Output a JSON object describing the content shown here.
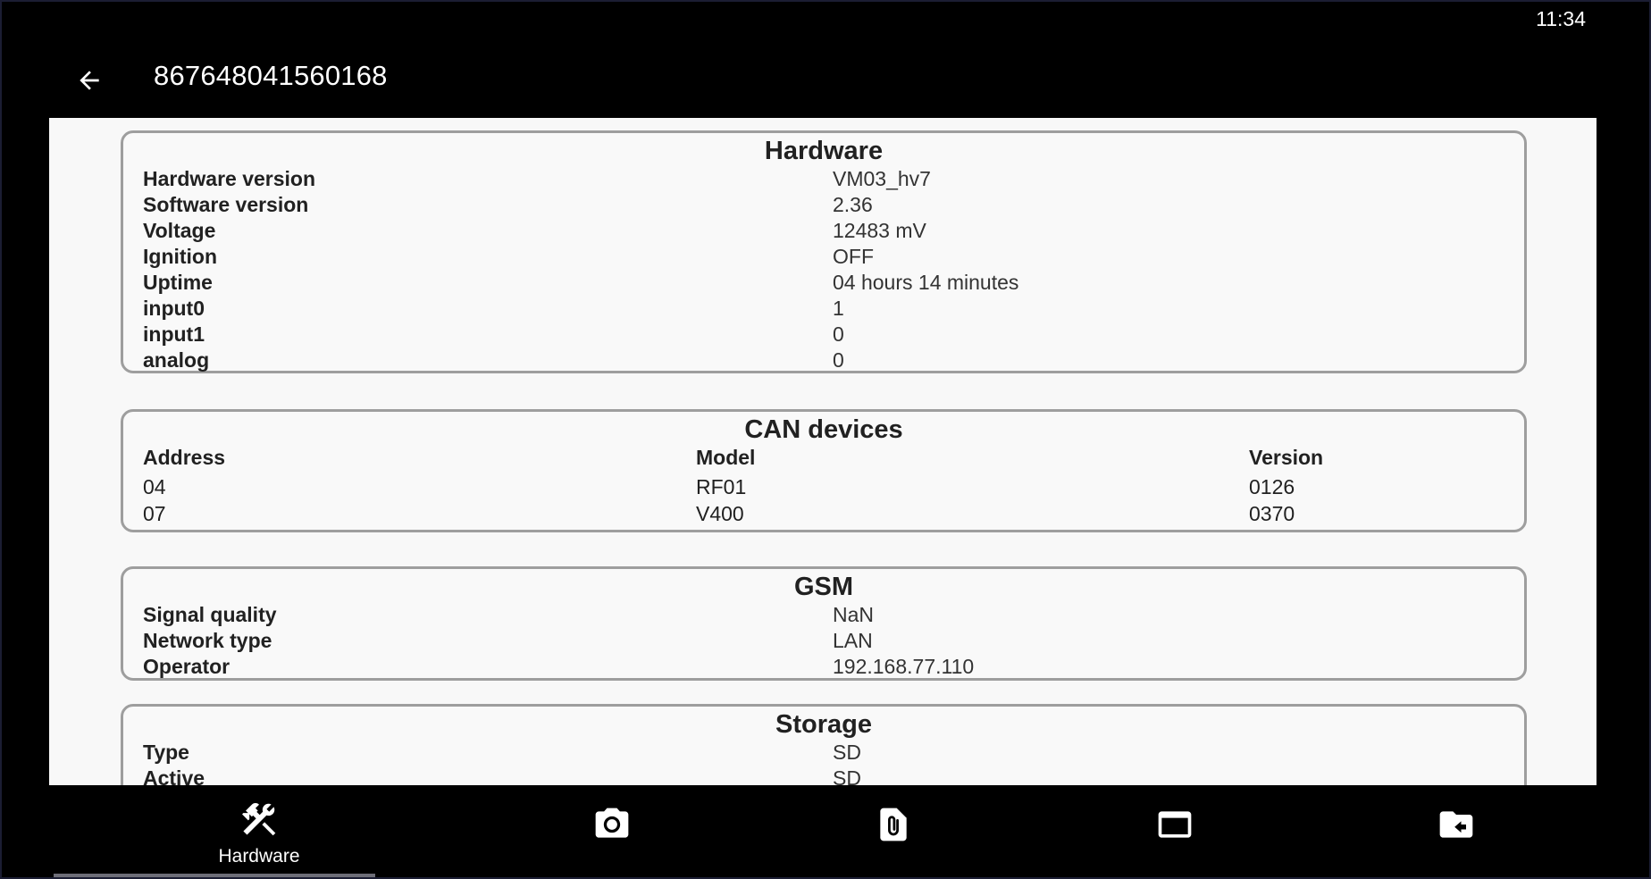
{
  "status_bar": {
    "time": "11:34"
  },
  "app_bar": {
    "title": "867648041560168",
    "back_icon": "arrow-left-icon"
  },
  "hardware": {
    "title": "Hardware",
    "rows": [
      {
        "key": "Hardware version",
        "value": "VM03_hv7"
      },
      {
        "key": "Software version",
        "value": "2.36"
      },
      {
        "key": "Voltage",
        "value": "12483 mV"
      },
      {
        "key": "Ignition",
        "value": "OFF"
      },
      {
        "key": "Uptime",
        "value": "04 hours 14 minutes"
      },
      {
        "key": "input0",
        "value": "1"
      },
      {
        "key": "input1",
        "value": "0"
      },
      {
        "key": "analog",
        "value": "0"
      }
    ]
  },
  "can_devices": {
    "title": "CAN devices",
    "headers": [
      "Address",
      "Model",
      "Version"
    ],
    "rows": [
      [
        "04",
        "RF01",
        "0126"
      ],
      [
        "07",
        "V400",
        "0370"
      ]
    ]
  },
  "gsm": {
    "title": "GSM",
    "rows": [
      {
        "key": "Signal quality",
        "value": "NaN"
      },
      {
        "key": "Network type",
        "value": "LAN"
      },
      {
        "key": "Operator",
        "value": "192.168.77.110"
      }
    ]
  },
  "storage": {
    "title": "Storage",
    "rows": [
      {
        "key": "Type",
        "value": "SD"
      },
      {
        "key": "Active",
        "value": "SD"
      }
    ]
  },
  "bottom_nav": {
    "items": [
      {
        "label": "Hardware",
        "icon": "tools-icon",
        "active": true
      },
      {
        "label": "",
        "icon": "camera-icon",
        "active": false
      },
      {
        "label": "",
        "icon": "attachment-icon",
        "active": false
      },
      {
        "label": "",
        "icon": "window-icon",
        "active": false
      },
      {
        "label": "",
        "icon": "folder-return-icon",
        "active": false
      }
    ]
  }
}
